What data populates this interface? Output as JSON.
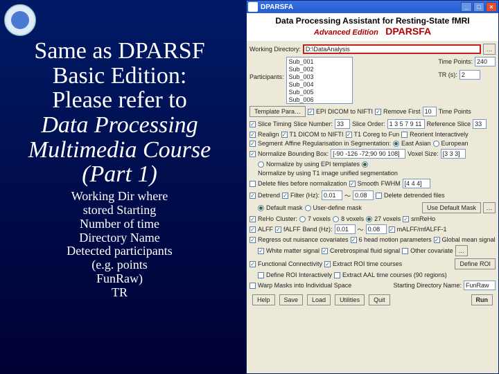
{
  "slide": {
    "heading_l1": "Same as DPARSF",
    "heading_l2": "Basic Edition:",
    "heading_l3": "Please refer to",
    "heading_l4": "Data Processing",
    "heading_l5": "Multimedia Course",
    "heading_l6": "(Part 1)",
    "sub_l1": "Working Dir where",
    "sub_l2": "stored Starting",
    "sub_l3": "Number of time",
    "sub_l4": "Directory Name",
    "sub_l5": "Detected participants",
    "sub_l6": "(e.g.",
    "sub_l7": "points",
    "sub_l8": "FunRaw)",
    "sub_l9": "TR"
  },
  "win": {
    "title": "DPARSFA",
    "header_line1": "Data Processing Assistant for Resting-State fMRI",
    "header_adv": "Advanced Edition",
    "header_brand": "DPARSFA",
    "workingdir_label": "Working Directory:",
    "workingdir_value": "D:\\DataAnalysis",
    "participants_label": "Participants:",
    "participants": [
      "Sub_001",
      "Sub_002",
      "Sub_003",
      "Sub_004",
      "Sub_005",
      "Sub_006"
    ],
    "timepoints_label": "Time Points:",
    "timepoints_value": "240",
    "tr_label": "TR (s):",
    "tr_value": "2",
    "template_label": "Template Para…",
    "epi2nifti": "EPI DICOM to NIFTI",
    "removefirst_label": "Remove First",
    "removefirst_value": "10",
    "removefirst_suffix": "Time Points",
    "slicetiming": "Slice Timing",
    "slicenum_label": "Slice Number:",
    "slicenum_value": "33",
    "sliceorder_label": "Slice Order:",
    "sliceorder_value": "1 3 5 7 9 11",
    "reference_label": "Reference Slice",
    "reference_value": "33",
    "realign": "Realign",
    "t1nifti": "T1 DICOM to NIFTI",
    "t1corag": "T1 Coreg to Fun",
    "reorient": "Reorient Interactively",
    "segment": "Segment",
    "affine_label": "Affine Regularisation in Segmentation:",
    "east_asian": "East Asian",
    "european": "European",
    "normalize": "Normalize",
    "bbox_label": "Bounding Box:",
    "bbox_value": "[-90 -126 -72;90 90 108]",
    "voxsize_label": "Voxel Size:",
    "voxsize_value": "[3 3 3]",
    "norm_epi": "Normalize by using EPI templates",
    "norm_t1": "Normalize by using T1 image unified segmentation",
    "delete_before": "Delete files before normalization",
    "smooth": "Smooth",
    "fwhm_label": "FWHM",
    "fwhm_value": "[4 4 4]",
    "detrend": "Detrend",
    "filter": "Filter (Hz):",
    "filter_lo": "0.01",
    "tilde": "～",
    "filter_hi": "0.08",
    "delete_detrended": "Delete detrended files",
    "default_mask": "Default mask",
    "user_mask": "User-define mask",
    "use_default_mask_btn": "Use Default Mask",
    "ellipsis": "…",
    "reho": "ReHo",
    "cluster_label": "Cluster:",
    "c7": "7 voxels",
    "c8": "8 voxels",
    "c27": "27 voxels",
    "smreho": "smReHo",
    "alff": "ALFF",
    "falff": "fALFF",
    "band_label": "Band (Hz):",
    "band_lo": "0.01",
    "band_hi": "0.08",
    "malff": "mALFF/mfALFF-1",
    "regress_cov": "Regress out nuisance covariates",
    "hm6": "6 head motion parameters",
    "global_mean": "Global mean signal",
    "white_signal": "White matter signal",
    "csf_signal": "Cerebrospinal fluid signal",
    "other_cov": "Other covariate",
    "fc": "Functional Connectivity",
    "extract_tc": "Extract ROI time courses",
    "define_roi_btn": "Define ROI",
    "define_roi_interactively": "Define ROI Interactively",
    "extract_aal": "Extract AAL time courses (90 regions)",
    "warp_masks": "Warp Masks into Individual Space",
    "startdir_label": "Starting Directory Name:",
    "startdir_value": "FunRaw",
    "help": "Help",
    "save": "Save",
    "load": "Load",
    "utilities": "Utilities",
    "quit": "Quit",
    "run": "Run"
  }
}
